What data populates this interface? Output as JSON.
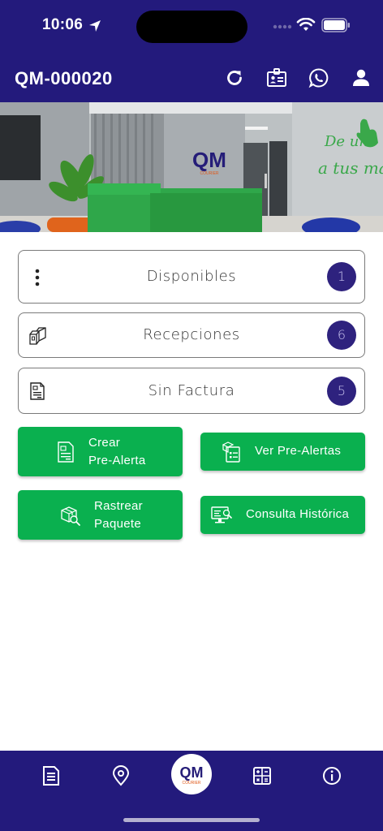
{
  "status_bar": {
    "time": "10:06"
  },
  "app_bar": {
    "title": "QM-000020",
    "icons": [
      "refresh-icon",
      "id-card-icon",
      "whatsapp-icon",
      "user-icon"
    ]
  },
  "hero": {
    "sign_text": "QM",
    "sign_subtext": "COURIER",
    "wall_text_1": "De un",
    "wall_text_2": "a tus man"
  },
  "cards": [
    {
      "label": "Disponibles",
      "count": "1",
      "icon": "more-vertical-icon"
    },
    {
      "label": "Recepciones",
      "count": "6",
      "icon": "boxes-icon"
    },
    {
      "label": "Sin Factura",
      "count": "5",
      "icon": "invoice-icon"
    }
  ],
  "actions": {
    "crear_line1": "Crear",
    "crear_line2": "Pre-Alerta",
    "ver": "Ver Pre-Alertas",
    "rastrear_line1": "Rastrear",
    "rastrear_line2": "Paquete",
    "consulta": "Consulta Histórica"
  },
  "bottom_nav": {
    "items": [
      "document-icon",
      "location-pin-icon",
      "qm-courier-logo",
      "calculator-icon",
      "info-icon"
    ],
    "logo_text": "QM",
    "logo_subtext": "COURIER"
  },
  "colors": {
    "primary": "#231a7c",
    "accent_green": "#0ab04f",
    "badge": "#2e227e"
  }
}
